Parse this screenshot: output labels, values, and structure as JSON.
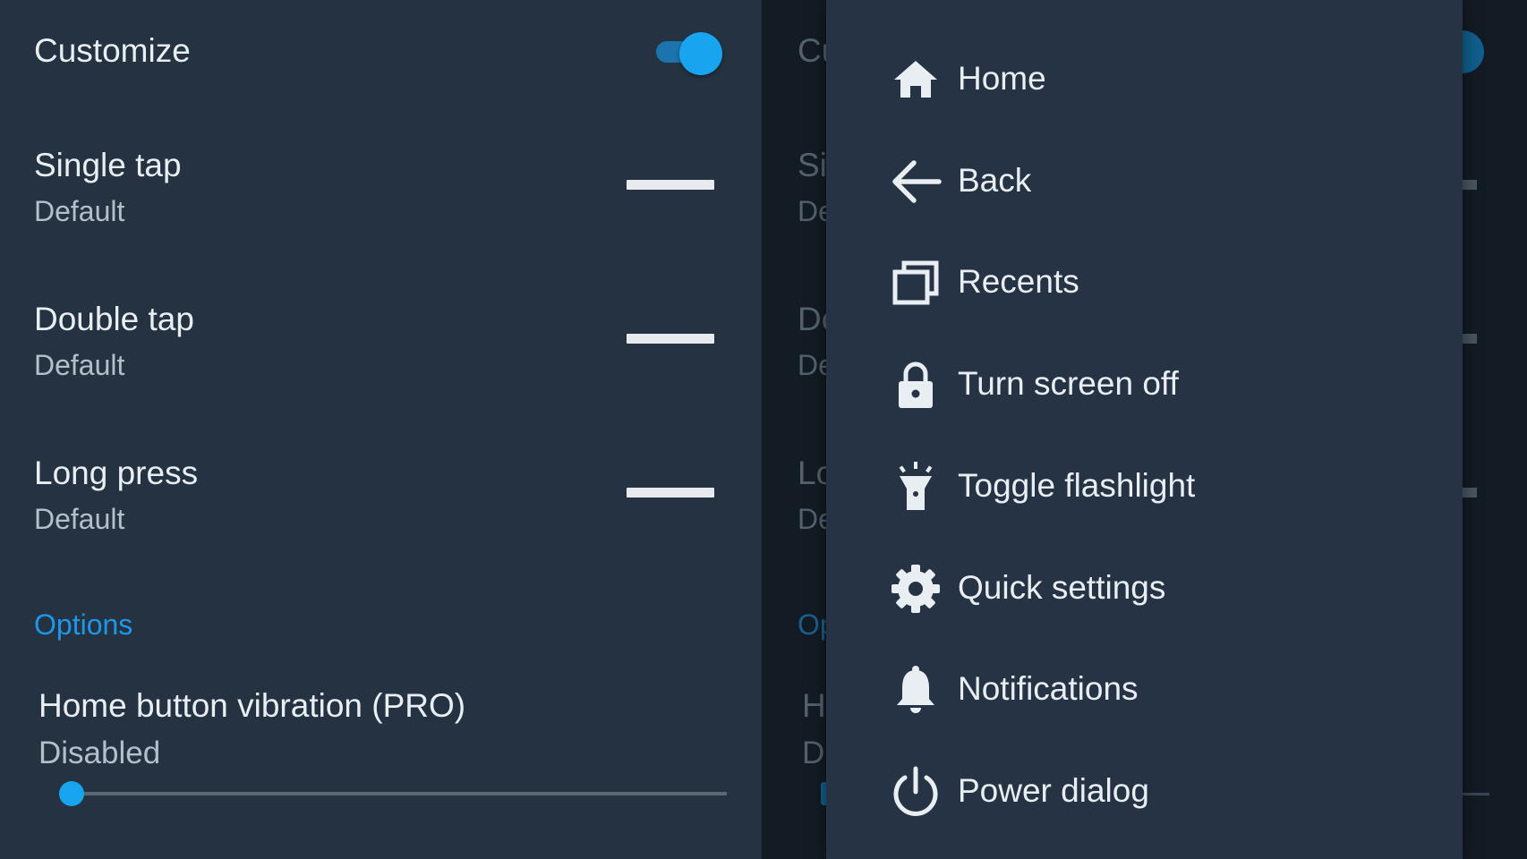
{
  "settings": {
    "customize": {
      "label": "Customize",
      "enabled": true
    },
    "rows": [
      {
        "title": "Single tap",
        "value": "Default"
      },
      {
        "title": "Double tap",
        "value": "Default"
      },
      {
        "title": "Long press",
        "value": "Default"
      }
    ],
    "options_header": "Options",
    "vibration": {
      "title": "Home button vibration (PRO)",
      "value": "Disabled",
      "level": 0
    }
  },
  "background_ghost": {
    "customize": "Cu",
    "rows": [
      {
        "title": "Si",
        "value": "De"
      },
      {
        "title": "Do",
        "value": "De"
      },
      {
        "title": "Lo",
        "value": "De"
      }
    ],
    "options": "Op",
    "vibration_title": "H",
    "vibration_value": "Di"
  },
  "menu": {
    "items": [
      {
        "label": "Home",
        "icon": "home-icon"
      },
      {
        "label": "Back",
        "icon": "back-arrow-icon"
      },
      {
        "label": "Recents",
        "icon": "recents-icon"
      },
      {
        "label": "Turn screen off",
        "icon": "lock-icon"
      },
      {
        "label": "Toggle flashlight",
        "icon": "flashlight-icon"
      },
      {
        "label": "Quick settings",
        "icon": "gear-icon"
      },
      {
        "label": "Notifications",
        "icon": "bell-icon"
      },
      {
        "label": "Power dialog",
        "icon": "power-icon"
      }
    ]
  },
  "colors": {
    "background": "#243242",
    "accent": "#19a4ef",
    "section_header": "#1e98e6",
    "text_primary": "#e9eef3",
    "text_secondary": "#b5bfca",
    "scrim": "#131b24"
  }
}
